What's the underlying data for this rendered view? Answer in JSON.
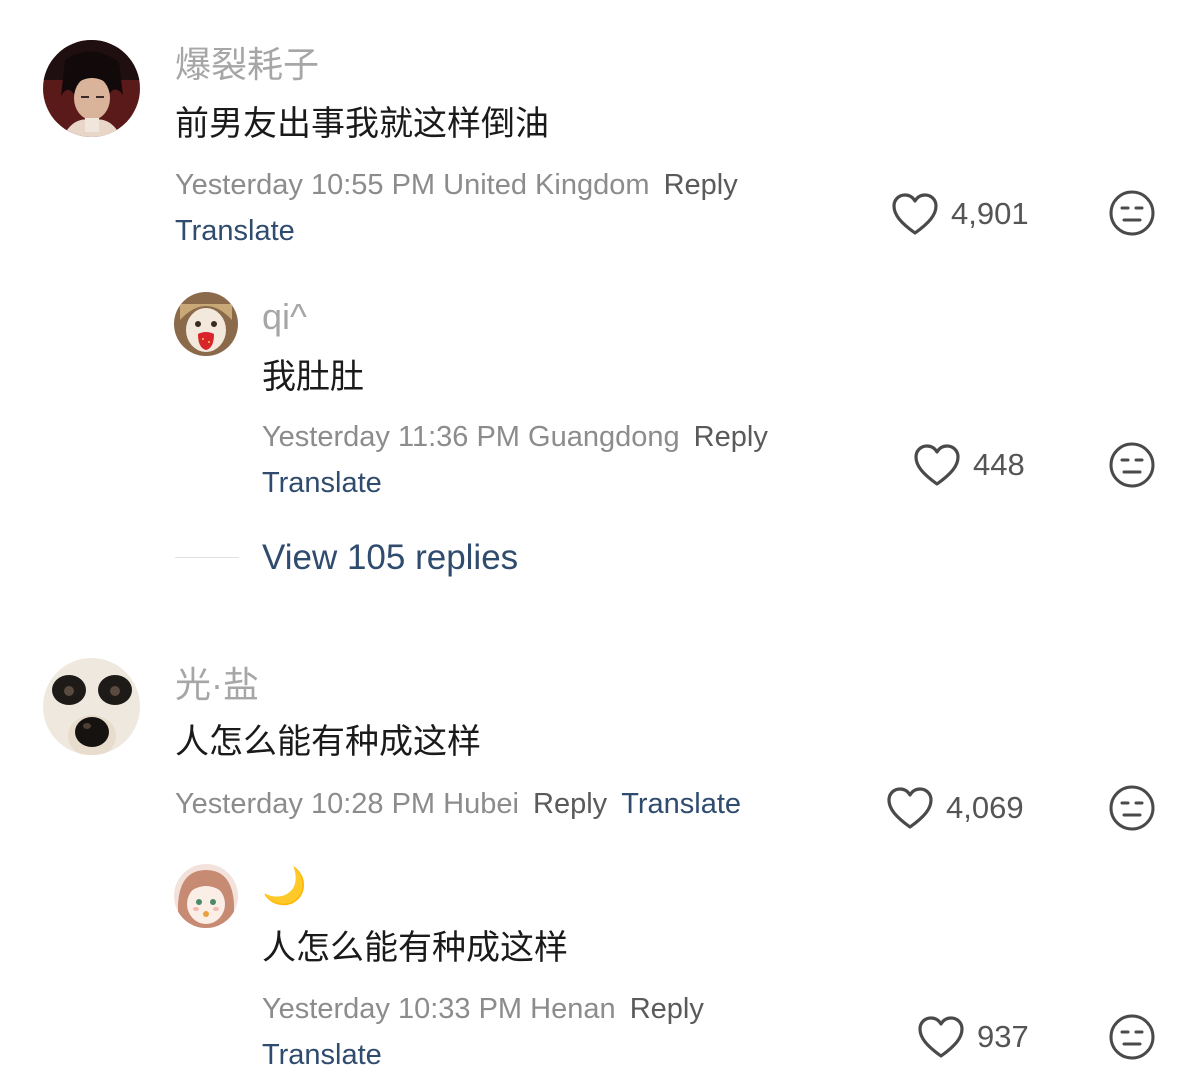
{
  "comments": [
    {
      "username": "爆裂耗子",
      "text": "前男友出事我就这样倒油",
      "time": "Yesterday 10:55 PM",
      "location": "United Kingdom",
      "reply": "Reply",
      "translate": "Translate",
      "likes": "4,901",
      "replies": [
        {
          "username": "qi^",
          "text": "我肚肚",
          "time": "Yesterday 11:36 PM",
          "location": "Guangdong",
          "reply": "Reply",
          "translate": "Translate",
          "likes": "448"
        }
      ],
      "view_replies": "View 105 replies"
    },
    {
      "username": "光·盐",
      "text": "人怎么能有种成这样",
      "time": "Yesterday 10:28 PM",
      "location": "Hubei",
      "reply": "Reply",
      "translate": "Translate",
      "likes": "4,069",
      "replies": [
        {
          "username": "🌙",
          "text": "人怎么能有种成这样",
          "time": "Yesterday 10:33 PM",
          "location": "Henan",
          "reply": "Reply",
          "translate": "Translate",
          "likes": "937"
        }
      ]
    }
  ],
  "colors": {
    "username": "#a6a6a6",
    "meta": "#8c8c8c",
    "link": "#2f4b6e",
    "text": "#1a1a1a"
  }
}
